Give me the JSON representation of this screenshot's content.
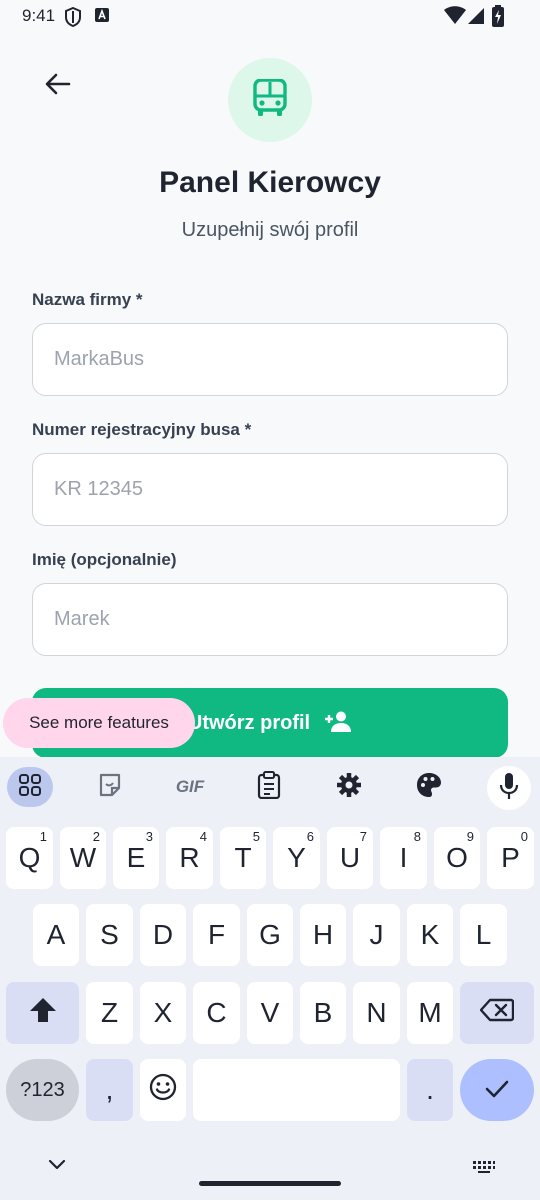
{
  "status_bar": {
    "time": "9:41"
  },
  "header": {
    "title": "Panel Kierowcy",
    "subtitle": "Uzupełnij swój profil"
  },
  "form": {
    "company_label": "Nazwa firmy *",
    "company_placeholder": "MarkaBus",
    "plate_label": "Numer rejestracyjny busa *",
    "plate_placeholder": "KR 12345",
    "name_label": "Imię (opcjonalnie)",
    "name_placeholder": "Marek",
    "submit_label": "Utwórz profil"
  },
  "tooltip": {
    "text": "See more features"
  },
  "keyboard": {
    "row1": [
      {
        "key": "Q",
        "hint": "1"
      },
      {
        "key": "W",
        "hint": "2"
      },
      {
        "key": "E",
        "hint": "3"
      },
      {
        "key": "R",
        "hint": "4"
      },
      {
        "key": "T",
        "hint": "5"
      },
      {
        "key": "Y",
        "hint": "6"
      },
      {
        "key": "U",
        "hint": "7"
      },
      {
        "key": "I",
        "hint": "8"
      },
      {
        "key": "O",
        "hint": "9"
      },
      {
        "key": "P",
        "hint": "0"
      }
    ],
    "row2": [
      "A",
      "S",
      "D",
      "F",
      "G",
      "H",
      "J",
      "K",
      "L"
    ],
    "row3": [
      "Z",
      "X",
      "C",
      "V",
      "B",
      "N",
      "M"
    ],
    "symbols_label": "?123",
    "comma_label": ",",
    "period_label": ".",
    "toolbar_gif_label": "GIF"
  },
  "colors": {
    "accent": "#10b981",
    "logo_bg": "#ddf7ea",
    "tooltip_bg": "#ffd6ec",
    "keyboard_bg": "#eef0f7"
  }
}
